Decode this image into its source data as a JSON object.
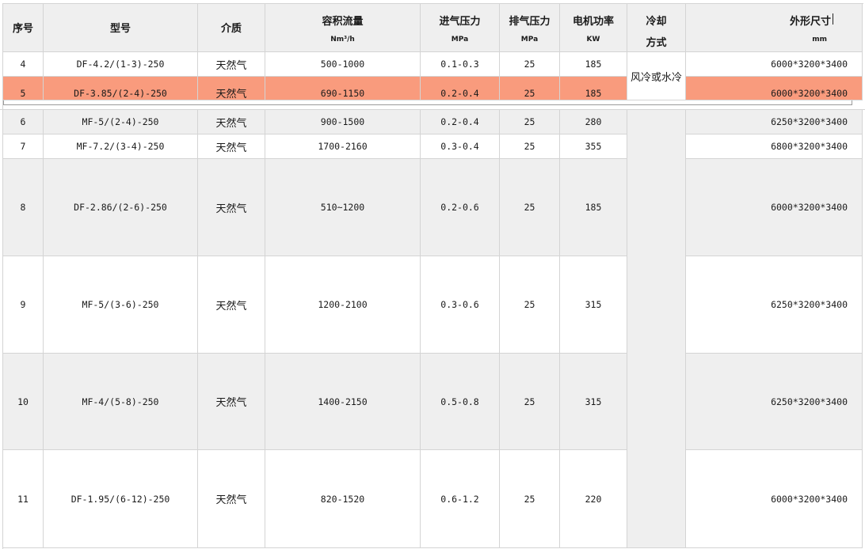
{
  "headers": {
    "seq": "序号",
    "model": "型号",
    "medium": "介质",
    "flow": "容积流量",
    "flow_unit": "Nm³/h",
    "inlet": "进气压力",
    "inlet_unit": "MPa",
    "outlet": "排气压力",
    "outlet_unit": "MPa",
    "motor": "电机功率",
    "motor_unit": "KW",
    "cooling_line1": "冷却",
    "cooling_line2": "方式",
    "dims": "外形尺寸",
    "dims_unit": "mm"
  },
  "cooling_value": "风冷或水冷",
  "highlight_color": "#f99b7d",
  "rows": [
    {
      "seq": "4",
      "model": "DF-4.2/(1-3)-250",
      "medium": "天然气",
      "flow": "500-1000",
      "inlet": "0.1-0.3",
      "outlet": "25",
      "motor": "185",
      "dims": "6000*3200*3400"
    },
    {
      "seq": "5",
      "model": "DF-3.85/(2-4)-250",
      "medium": "天然气",
      "flow": "690-1150",
      "inlet": "0.2-0.4",
      "outlet": "25",
      "motor": "185",
      "dims": "6000*3200*3400"
    },
    {
      "seq": "6",
      "model": "MF-5/(2-4)-250",
      "medium": "天然气",
      "flow": "900-1500",
      "inlet": "0.2-0.4",
      "outlet": "25",
      "motor": "280",
      "dims": "6250*3200*3400"
    },
    {
      "seq": "7",
      "model": "MF-7.2/(3-4)-250",
      "medium": "天然气",
      "flow": "1700-2160",
      "inlet": "0.3-0.4",
      "outlet": "25",
      "motor": "355",
      "dims": "6800*3200*3400"
    },
    {
      "seq": "8",
      "model": "DF-2.86/(2-6)-250",
      "medium": "天然气",
      "flow": "510~1200",
      "inlet": "0.2-0.6",
      "outlet": "25",
      "motor": "185",
      "dims": "6000*3200*3400"
    },
    {
      "seq": "9",
      "model": "MF-5/(3-6)-250",
      "medium": "天然气",
      "flow": "1200-2100",
      "inlet": "0.3-0.6",
      "outlet": "25",
      "motor": "315",
      "dims": "6250*3200*3400"
    },
    {
      "seq": "10",
      "model": "MF-4/(5-8)-250",
      "medium": "天然气",
      "flow": "1400-2150",
      "inlet": "0.5-0.8",
      "outlet": "25",
      "motor": "315",
      "dims": "6250*3200*3400"
    },
    {
      "seq": "11",
      "model": "DF-1.95/(6-12)-250",
      "medium": "天然气",
      "flow": "820-1520",
      "inlet": "0.6-1.2",
      "outlet": "25",
      "motor": "220",
      "dims": "6000*3200*3400"
    }
  ]
}
